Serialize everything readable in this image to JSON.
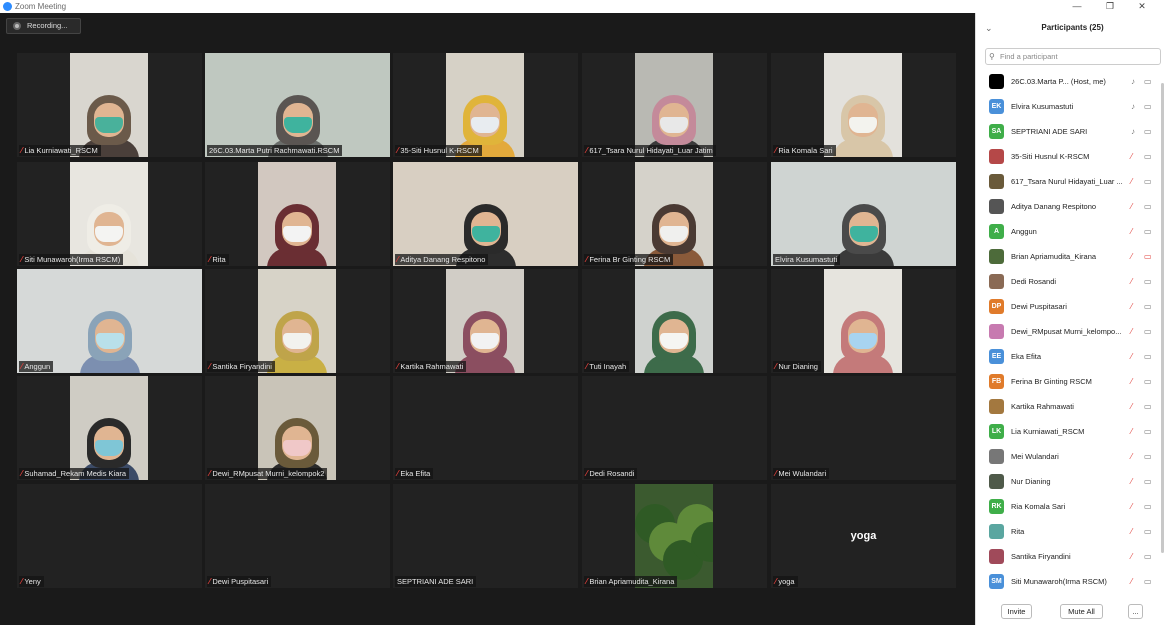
{
  "window": {
    "title": "Zoom Meeting"
  },
  "recording": {
    "label": "Recording..."
  },
  "tiles": [
    {
      "name": "Lia Kurniawati_RSCM",
      "mic": "off"
    },
    {
      "name": "26C.03.Marta Putri Rachmawati.RSCM",
      "mic": "none",
      "active": true
    },
    {
      "name": "35-Siti Husnul K-RSCM",
      "mic": "off"
    },
    {
      "name": "617_Tsara Nurul Hidayati_Luar Jatim",
      "mic": "off"
    },
    {
      "name": "Ria Komala Sari",
      "mic": "off"
    },
    {
      "name": "Siti Munawaroh(Irma RSCM)",
      "mic": "off"
    },
    {
      "name": "Rita",
      "mic": "off"
    },
    {
      "name": "Aditya Danang Respitono",
      "mic": "off"
    },
    {
      "name": "Ferina Br Ginting RSCM",
      "mic": "off"
    },
    {
      "name": "Elvira Kusumastuti",
      "mic": "none"
    },
    {
      "name": "Anggun",
      "mic": "off"
    },
    {
      "name": "Santika Firyandini",
      "mic": "off"
    },
    {
      "name": "Kartika Rahmawati",
      "mic": "off"
    },
    {
      "name": "Tuti Inayah",
      "mic": "off"
    },
    {
      "name": "Nur Dianing",
      "mic": "off"
    },
    {
      "name": "Suhamad_Rekam Medis Kiara",
      "mic": "off"
    },
    {
      "name": "Dewi_RMpusat Murni_kelompok2",
      "mic": "off"
    },
    {
      "name": "Eka Efita",
      "mic": "off"
    },
    {
      "name": "Dedi Rosandi",
      "mic": "off"
    },
    {
      "name": "Mei Wulandari",
      "mic": "off"
    },
    {
      "name": "Yeny",
      "mic": "off"
    },
    {
      "name": "Dewi Puspitasari",
      "mic": "off"
    },
    {
      "name": "SEPTRIANI ADE SARI",
      "mic": "none"
    },
    {
      "name": "Brian Apriamudita_Kirana",
      "mic": "off"
    },
    {
      "name": "yoga",
      "mic": "off",
      "bigname": "yoga"
    }
  ],
  "panel": {
    "title": "Participants (25)",
    "search_placeholder": "Find a participant",
    "participants": [
      {
        "name": "26C.03.Marta P...",
        "tag": "(Host, me)",
        "initials": "",
        "color": "#000000",
        "mic": "on",
        "video": "on"
      },
      {
        "name": "Elvira Kusumastuti",
        "initials": "EK",
        "color": "#4a90d9",
        "mic": "on",
        "video": "on"
      },
      {
        "name": "SEPTRIANI ADE SARI",
        "initials": "SA",
        "color": "#3fae49",
        "mic": "on",
        "video": "on"
      },
      {
        "name": "35-Siti Husnul K-RSCM",
        "initials": "",
        "color": "#b54848",
        "mic": "off",
        "video": "on"
      },
      {
        "name": "617_Tsara Nurul Hidayati_Luar ...",
        "initials": "",
        "color": "#6a5a3a",
        "mic": "off",
        "video": "on"
      },
      {
        "name": "Aditya Danang Respitono",
        "initials": "",
        "color": "#555555",
        "mic": "off",
        "video": "on"
      },
      {
        "name": "Anggun",
        "initials": "A",
        "color": "#3fae49",
        "mic": "off",
        "video": "on"
      },
      {
        "name": "Brian Apriamudita_Kirana",
        "initials": "",
        "color": "#4d6b3a",
        "mic": "off",
        "video": "off"
      },
      {
        "name": "Dedi Rosandi",
        "initials": "",
        "color": "#8a6a55",
        "mic": "off",
        "video": "on"
      },
      {
        "name": "Dewi Puspitasari",
        "initials": "DP",
        "color": "#e07b2b",
        "mic": "off",
        "video": "on"
      },
      {
        "name": "Dewi_RMpusat Murni_kelompo...",
        "initials": "",
        "color": "#c77ab0",
        "mic": "off",
        "video": "on"
      },
      {
        "name": "Eka Efita",
        "initials": "EE",
        "color": "#4a90d9",
        "mic": "off",
        "video": "on"
      },
      {
        "name": "Ferina Br Ginting RSCM",
        "initials": "FB",
        "color": "#e07b2b",
        "mic": "off",
        "video": "on"
      },
      {
        "name": "Kartika Rahmawati",
        "initials": "",
        "color": "#a3783f",
        "mic": "off",
        "video": "on"
      },
      {
        "name": "Lia Kurniawati_RSCM",
        "initials": "LK",
        "color": "#3fae49",
        "mic": "off",
        "video": "on"
      },
      {
        "name": "Mei Wulandari",
        "initials": "",
        "color": "#777777",
        "mic": "off",
        "video": "on"
      },
      {
        "name": "Nur Dianing",
        "initials": "",
        "color": "#4f5a4a",
        "mic": "off",
        "video": "on"
      },
      {
        "name": "Ria Komala Sari",
        "initials": "RK",
        "color": "#3fae49",
        "mic": "off",
        "video": "on"
      },
      {
        "name": "Rita",
        "initials": "",
        "color": "#5aa6a0",
        "mic": "off",
        "video": "on"
      },
      {
        "name": "Santika Firyandini",
        "initials": "",
        "color": "#a04a5a",
        "mic": "off",
        "video": "on"
      },
      {
        "name": "Siti Munawaroh(Irma RSCM)",
        "initials": "SM",
        "color": "#4a90d9",
        "mic": "off",
        "video": "on"
      }
    ],
    "invite_label": "Invite",
    "mute_all_label": "Mute All",
    "more_label": "..."
  },
  "colors": {
    "accent": "#2d8cff",
    "active_speaker": "#b7e04a",
    "muted": "#e0413c"
  }
}
